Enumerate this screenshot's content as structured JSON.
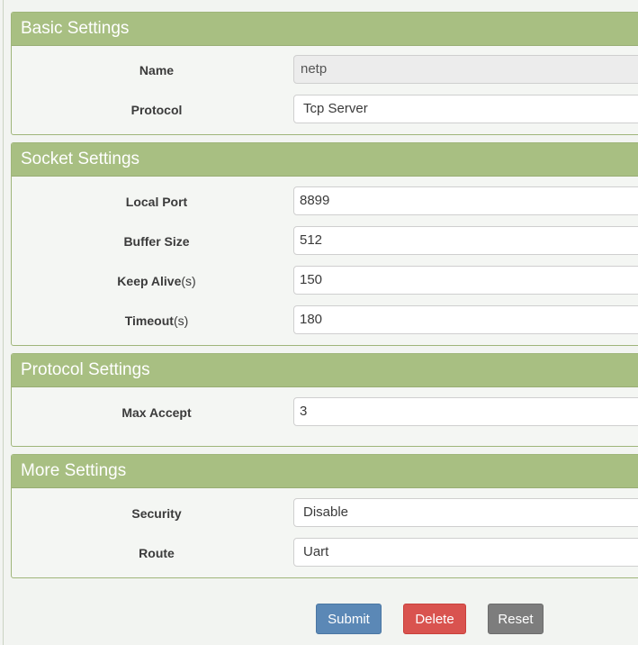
{
  "sections": {
    "basic": {
      "title": "Basic Settings",
      "name_label": "Name",
      "name_value": "netp",
      "protocol_label": "Protocol",
      "protocol_value": "Tcp Server"
    },
    "socket": {
      "title": "Socket Settings",
      "local_port_label": "Local Port",
      "local_port_value": "8899",
      "buffer_size_label": "Buffer Size",
      "buffer_size_value": "512",
      "keep_alive_label": "Keep Alive",
      "keep_alive_unit": "(s)",
      "keep_alive_value": "150",
      "timeout_label": "Timeout",
      "timeout_unit": "(s)",
      "timeout_value": "180"
    },
    "protocol": {
      "title": "Protocol Settings",
      "max_accept_label": "Max Accept",
      "max_accept_value": "3"
    },
    "more": {
      "title": "More Settings",
      "security_label": "Security",
      "security_value": "Disable",
      "route_label": "Route",
      "route_value": "Uart"
    }
  },
  "actions": {
    "submit_label": "Submit",
    "delete_label": "Delete",
    "reset_label": "Reset"
  },
  "colors": {
    "header": "#a8bf82",
    "submit": "#5b88b6",
    "delete": "#d9534f",
    "reset": "#7d7d7d"
  }
}
